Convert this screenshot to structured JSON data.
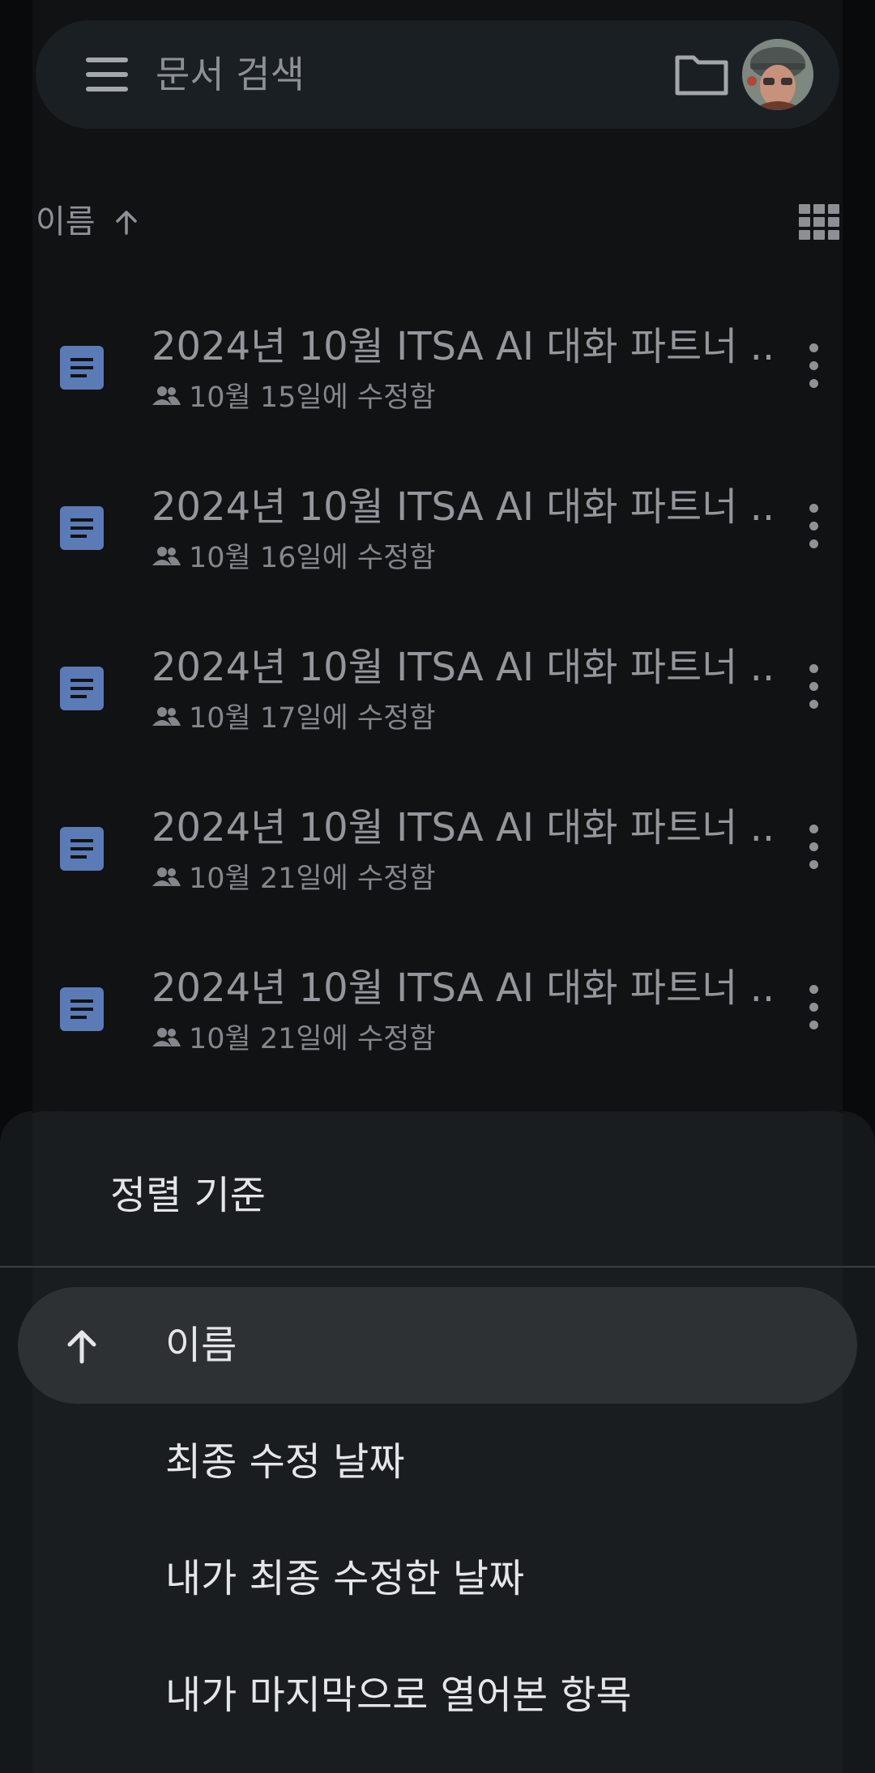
{
  "search": {
    "placeholder": "문서 검색"
  },
  "sort_header": {
    "label": "이름"
  },
  "files": [
    {
      "title": "2024년 10월 ITSA AI 대화 파트너 ...",
      "modified": "10월 15일에 수정함"
    },
    {
      "title": "2024년 10월 ITSA AI 대화 파트너 ...",
      "modified": "10월 16일에 수정함"
    },
    {
      "title": "2024년 10월 ITSA AI 대화 파트너 ...",
      "modified": "10월 17일에 수정함"
    },
    {
      "title": "2024년 10월 ITSA AI 대화 파트너 ...",
      "modified": "10월 21일에 수정함"
    },
    {
      "title": "2024년 10월 ITSA AI 대화 파트너 ...",
      "modified": "10월 21일에 수정함"
    }
  ],
  "sort_sheet": {
    "title": "정렬 기준",
    "options": [
      {
        "label": "이름",
        "selected": true,
        "direction": "ascending"
      },
      {
        "label": "최종 수정 날짜",
        "selected": false
      },
      {
        "label": "내가 최종 수정한 날짜",
        "selected": false
      },
      {
        "label": "내가 마지막으로 열어본 항목",
        "selected": false
      }
    ]
  },
  "icons": {
    "menu": "menu-icon",
    "folder": "folder-icon",
    "avatar": "avatar",
    "sort_arrow": "arrow-up-icon",
    "grid_view": "grid-view-icon",
    "document": "document-icon",
    "shared": "shared-people-icon",
    "more": "more-vertical-icon"
  },
  "colors": {
    "doc_icon": "#5b7bb6",
    "sheet_bg": "#1a1d20",
    "selected_option_bg": "#2d3134"
  }
}
